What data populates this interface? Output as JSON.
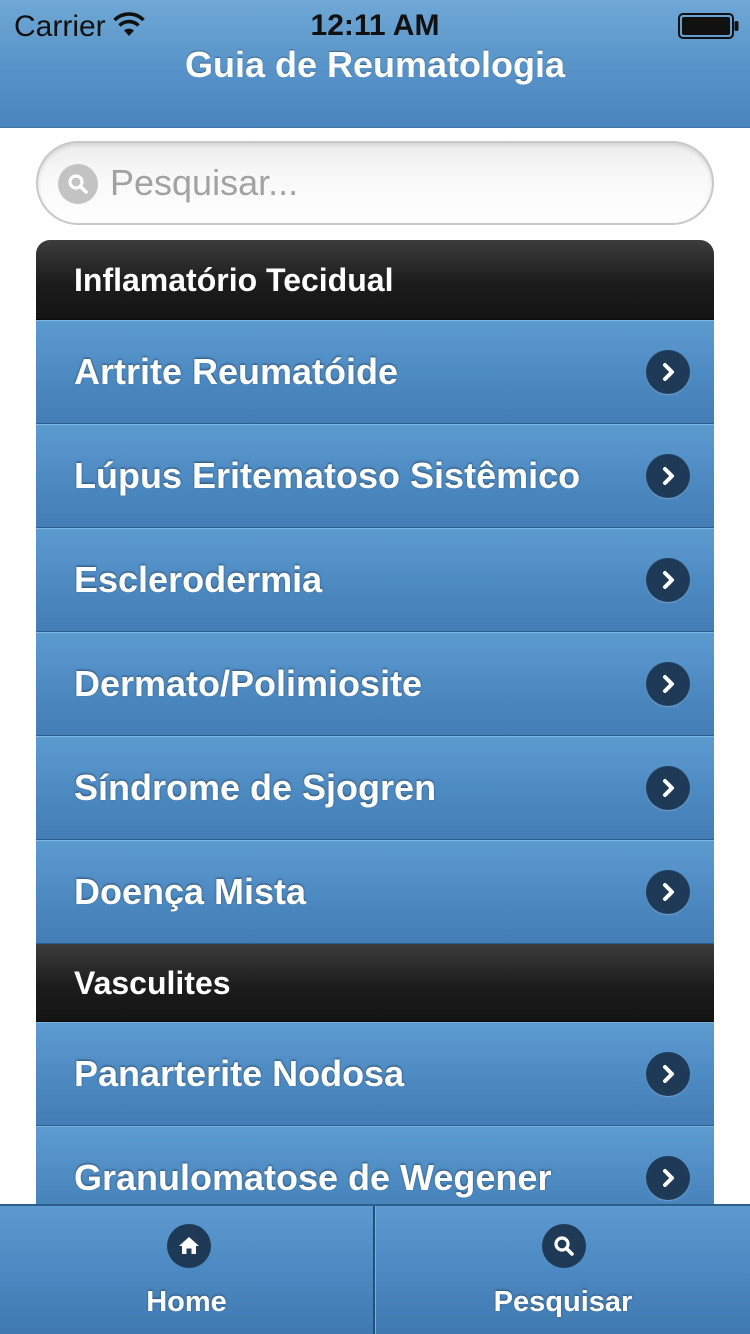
{
  "status_bar": {
    "carrier": "Carrier",
    "time": "12:11 AM",
    "icons": [
      "wifi-icon",
      "battery-icon"
    ]
  },
  "header": {
    "title": "Guia de Reumatologia"
  },
  "search": {
    "placeholder": "Pesquisar...",
    "value": "",
    "icon": "search-icon"
  },
  "list": {
    "sections": [
      {
        "title": "Inflamatório Tecidual",
        "items": [
          "Artrite Reumatóide",
          "Lúpus Eritematoso Sistêmico",
          "Esclerodermia",
          "Dermato/Polimiosite",
          "Síndrome de Sjogren",
          "Doença Mista"
        ]
      },
      {
        "title": "Vasculites",
        "items": [
          "Panarterite Nodosa",
          "Granulomatose de Wegener"
        ]
      }
    ],
    "item_icon": "chevron-right-icon"
  },
  "tab_bar": {
    "tabs": [
      {
        "label": "Home",
        "icon": "home-icon"
      },
      {
        "label": "Pesquisar",
        "icon": "search-icon"
      }
    ]
  },
  "colors": {
    "header_blue": "#5793c8",
    "item_blue": "#4e8bc3",
    "divider_black": "#1c1c1c",
    "icon_circle": "#1f3a56"
  }
}
